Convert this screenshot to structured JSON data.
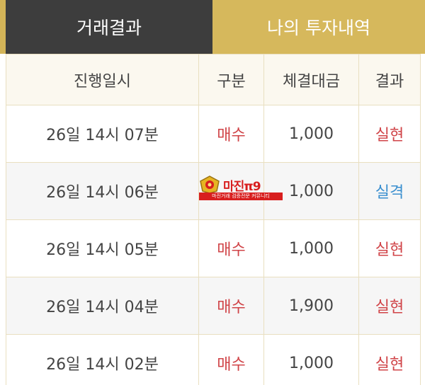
{
  "tabs": {
    "trade_results": "거래결과",
    "my_history": "나의 투자내역"
  },
  "table": {
    "headers": [
      "진행일시",
      "구분",
      "체결대금",
      "결과"
    ],
    "rows": [
      {
        "datetime": "26일 14시 07분",
        "type": "매수",
        "amount": "1,000",
        "result": "실현"
      },
      {
        "datetime": "26일 14시 06분",
        "type": "",
        "amount": "1,000",
        "result": "실격"
      },
      {
        "datetime": "26일 14시 05분",
        "type": "매수",
        "amount": "1,000",
        "result": "실현"
      },
      {
        "datetime": "26일 14시 04분",
        "type": "매수",
        "amount": "1,900",
        "result": "실현"
      },
      {
        "datetime": "26일 14시 02분",
        "type": "매수",
        "amount": "1,000",
        "result": "실현"
      }
    ]
  },
  "watermark": {
    "title": "마진π9",
    "subtitle": "마진거래 검증전문 커뮤니티"
  },
  "colors": {
    "tab_dark": "#3d3d3d",
    "tab_gold": "#d6b85c",
    "buy_red": "#d04448",
    "fail_blue": "#3a8fcf"
  }
}
